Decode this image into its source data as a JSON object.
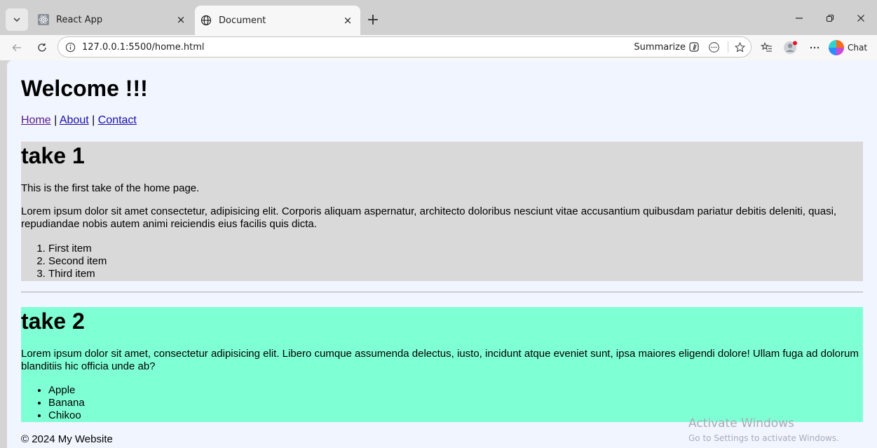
{
  "browser": {
    "tabs": [
      {
        "title": "React App",
        "active": false,
        "favicon": "react-favicon-icon"
      },
      {
        "title": "Document",
        "active": true,
        "favicon": "globe-icon"
      }
    ],
    "close_glyph": "×",
    "new_tab_glyph": "+",
    "address": {
      "url": "127.0.0.1:5500/home.html",
      "summarize_label": "Summarize"
    },
    "chat_label": "Chat"
  },
  "page": {
    "heading": "Welcome !!!",
    "nav": {
      "home": "Home",
      "about": "About",
      "contact": "Contact",
      "separator": "|"
    },
    "take1": {
      "title": "take 1",
      "intro": "This is the first take of the home page.",
      "lorem": "Lorem ipsum dolor sit amet consectetur, adipisicing elit. Corporis aliquam aspernatur, architecto doloribus nesciunt vitae accusantium quibusdam pariatur debitis deleniti, quasi, repudiandae nobis autem animi reiciendis eius facilis quis dicta.",
      "items": [
        "First item",
        "Second item",
        "Third item"
      ],
      "background": "#d9d9d9"
    },
    "take2": {
      "title": "take 2",
      "lorem": "Lorem ipsum dolor sit amet, consectetur adipisicing elit. Libero cumque assumenda delectus, iusto, incidunt atque eveniet sunt, ipsa maiores eligendi dolore! Ullam fuga ad dolorum blanditiis hic officia unde ab?",
      "items": [
        "Apple",
        "Banana",
        "Chikoo"
      ],
      "background": "#7fffd4"
    },
    "footer": "© 2024 My Website"
  },
  "watermark": {
    "line1": "Activate Windows",
    "line2": "Go to Settings to activate Windows."
  }
}
